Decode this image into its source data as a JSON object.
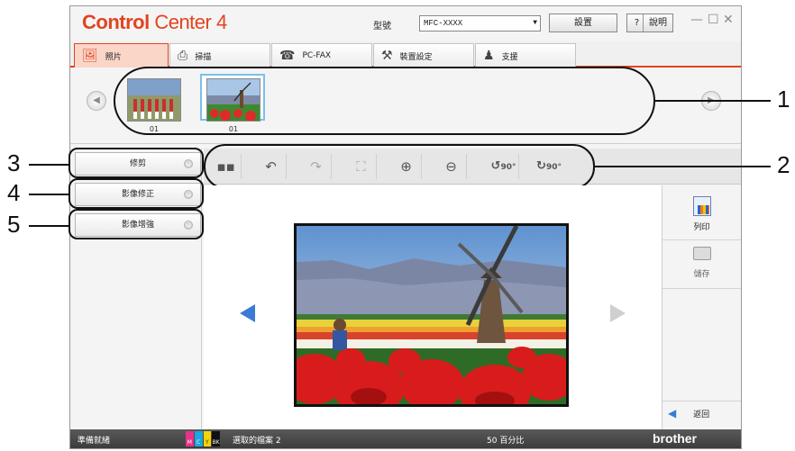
{
  "app": {
    "brand_bold": "Control",
    "brand_rest": " Center 4",
    "model_label": "型號",
    "model_value": "MFC-XXXX",
    "settings_label": "設置",
    "help_label": "說明",
    "help_icon": "?"
  },
  "tabs": [
    {
      "label": "照片",
      "icon": "photo-icon"
    },
    {
      "label": "掃描",
      "icon": "scan-icon"
    },
    {
      "label": "PC-FAX",
      "icon": "fax-icon"
    },
    {
      "label": "裝置設定",
      "icon": "tools-icon"
    },
    {
      "label": "支援",
      "icon": "support-icon"
    }
  ],
  "thumbnails": [
    {
      "label": "01"
    },
    {
      "label": "01"
    }
  ],
  "sidebar": {
    "buttons": [
      "修剪",
      "影像修正",
      "影像增強"
    ]
  },
  "toolbar": {
    "tools": [
      "view-mode-icon",
      "undo-icon",
      "redo-icon",
      "fit-icon",
      "zoom-in-icon",
      "zoom-out-icon",
      "rotate-left-icon",
      "rotate-right-icon"
    ],
    "rotate_left_label": "90°",
    "rotate_right_label": "90°"
  },
  "rightpanel": {
    "print_label": "列印",
    "save_label": "儲存",
    "back_label": "返回"
  },
  "status": {
    "ready": "準備就緒",
    "ink_labels": [
      "M",
      "C",
      "Y",
      "BK"
    ],
    "selected": "選取的檔案 2",
    "zoom": "50 百分比",
    "brand": "brother"
  },
  "callouts": [
    "1",
    "2",
    "3",
    "4",
    "5"
  ],
  "colors": {
    "accent": "#e2441f",
    "status_bg": "#4a4a4a",
    "nav_arrow": "#3a7bd5"
  }
}
